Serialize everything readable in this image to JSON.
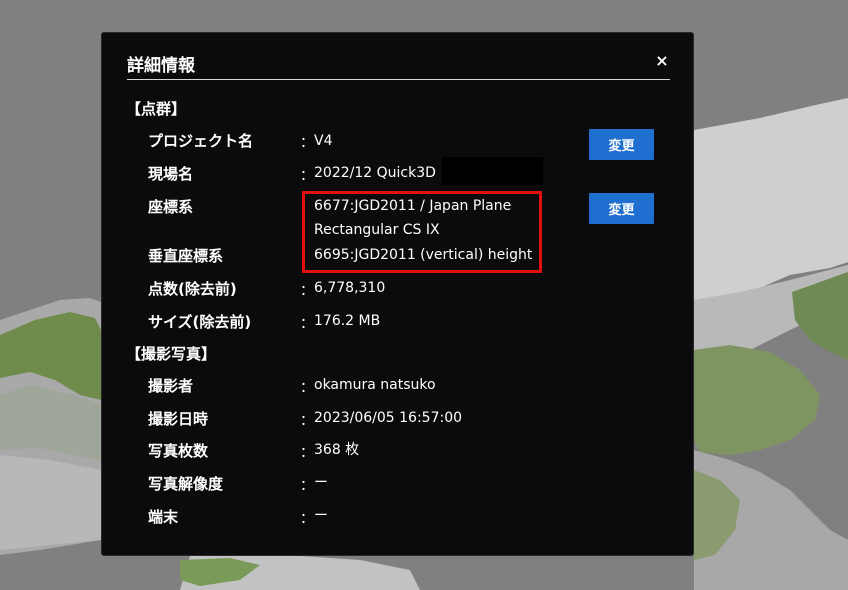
{
  "modal": {
    "title": "詳細情報",
    "close_label": "×"
  },
  "point_cloud": {
    "section_label": "【点群】",
    "project_name": {
      "label": "プロジェクト名",
      "value": "V4",
      "button": "変更"
    },
    "site_name": {
      "label": "現場名",
      "value": "2022/12 Quick3D"
    },
    "coordinate_system": {
      "label": "座標系",
      "value_line1": "6677:JGD2011 / Japan Plane",
      "value_line2": "Rectangular CS IX",
      "button": "変更"
    },
    "vertical_system": {
      "label": "垂直座標系",
      "value": "6695:JGD2011 (vertical) height"
    },
    "point_count": {
      "label": "点数(除去前)",
      "value": "6,778,310"
    },
    "size": {
      "label": "サイズ(除去前)",
      "value": "176.2 MB"
    }
  },
  "photos": {
    "section_label": "【撮影写真】",
    "photographer": {
      "label": "撮影者",
      "value": "okamura natsuko"
    },
    "datetime": {
      "label": "撮影日時",
      "value": "2023/06/05 16:57:00"
    },
    "photo_count": {
      "label": "写真枚数",
      "value": "368 枚"
    },
    "resolution": {
      "label": "写真解像度",
      "value": "ー"
    },
    "device": {
      "label": "端末",
      "value": "ー"
    }
  },
  "colon": "："
}
